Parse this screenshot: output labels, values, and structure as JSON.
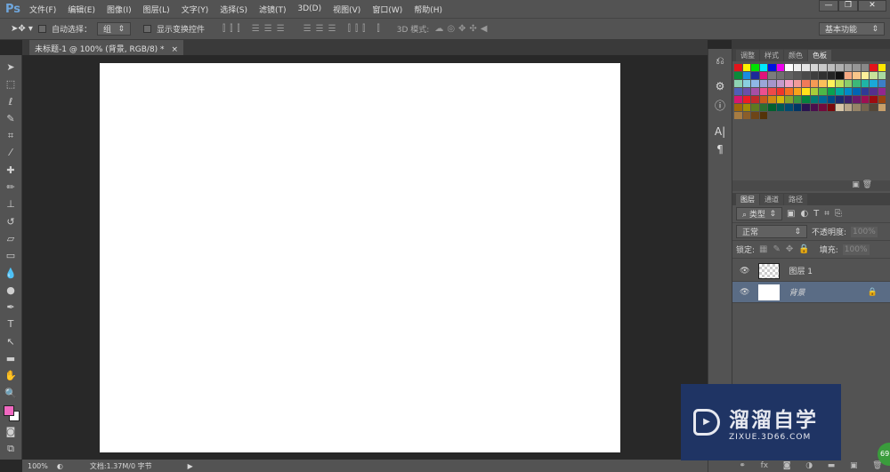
{
  "app": {
    "logo": "Ps"
  },
  "menu": [
    "文件(F)",
    "编辑(E)",
    "图像(I)",
    "图层(L)",
    "文字(Y)",
    "选择(S)",
    "滤镜(T)",
    "3D(D)",
    "视图(V)",
    "窗口(W)",
    "帮助(H)"
  ],
  "window_buttons": {
    "minimize": "—",
    "restore": "❐",
    "close": "✕"
  },
  "options": {
    "auto_select_label": "自动选择：",
    "auto_select_value": "组",
    "show_transform_label": "显示变换控件",
    "mode3d_label": "3D 模式:",
    "workspace": "基本功能"
  },
  "document_tab": {
    "title": "未标题-1 @ 100% (背景, RGB/8) *",
    "close": "×"
  },
  "panels": {
    "top_tabs": [
      "调整",
      "样式",
      "颜色",
      "色板"
    ],
    "swatches": [
      "#e3141b",
      "#fff200",
      "#00e400",
      "#00eaff",
      "#0013e0",
      "#ee00ee",
      "#ffffff",
      "#f0f0f0",
      "#e4e4e4",
      "#d6d6d6",
      "#cacaca",
      "#bdbdbd",
      "#b0b0b0",
      "#a3a3a3",
      "#969696",
      "#898989",
      "#e3141b",
      "#ffe800",
      "#0a8a3a",
      "#1a8ce0",
      "#1c2a9a",
      "#e0137b",
      "#7c7c7c",
      "#6f6f6f",
      "#636363",
      "#575757",
      "#4a4a4a",
      "#3e3e3e",
      "#313131",
      "#252525",
      "#111111",
      "#f5a882",
      "#f8c58a",
      "#fff09a",
      "#c8e29a",
      "#a9d9a1",
      "#8ed3b2",
      "#89cfe0",
      "#8fb8e6",
      "#9aa6d8",
      "#a596cc",
      "#c59bcc",
      "#f2a1c4",
      "#f29a9a",
      "#f07a5a",
      "#f59a55",
      "#fbc05a",
      "#fff25a",
      "#c4df5a",
      "#8ccd6a",
      "#3cb878",
      "#1fb5a6",
      "#1aa8d8",
      "#3b7fc8",
      "#4f5fb5",
      "#6b4fa8",
      "#a64fa5",
      "#ec4f8f",
      "#ee4a4a",
      "#f0352a",
      "#f36f21",
      "#f7a21b",
      "#ffe21a",
      "#a6cd39",
      "#4cb848",
      "#0aa14f",
      "#00a79d",
      "#0089c7",
      "#0065b3",
      "#2e3b96",
      "#55308d",
      "#92278f",
      "#d6166f",
      "#ed1c24",
      "#c12a2a",
      "#c6591a",
      "#cf8a12",
      "#d2b80c",
      "#86a52b",
      "#3c9740",
      "#05823e",
      "#007a72",
      "#006796",
      "#004a87",
      "#1d2a6f",
      "#3c1f6b",
      "#6b1a6a",
      "#9c0f52",
      "#9d0b0f",
      "#9a4310",
      "#9e680a",
      "#a18c06",
      "#5f7a21",
      "#2b6f30",
      "#02602e",
      "#005a55",
      "#004b70",
      "#003665",
      "#2a1450",
      "#4a0f4e",
      "#730a3c",
      "#78080b",
      "#d8c6a8",
      "#b8a58a",
      "#968468",
      "#73644e",
      "#544738",
      "#c8a06a",
      "#a77c42",
      "#8b5e2a",
      "#6e4518",
      "#543309"
    ],
    "layer_tabs": [
      "图层",
      "通道",
      "路径"
    ],
    "filter_label": "类型",
    "blend_mode": "正常",
    "opacity_label": "不透明度:",
    "opacity_value": "100%",
    "lock_label": "锁定:",
    "fill_label": "填充:",
    "fill_value": "100%",
    "layers": [
      {
        "name": "图层 1",
        "selected": false,
        "locked": false
      },
      {
        "name": "背景",
        "selected": true,
        "locked": true
      }
    ]
  },
  "status": {
    "zoom": "100%",
    "doc_info": "文档:1.37M/0 字节"
  },
  "watermark": {
    "title": "溜溜自学",
    "subtitle": "ZIXUE.3D66.COM"
  },
  "badge": "69"
}
